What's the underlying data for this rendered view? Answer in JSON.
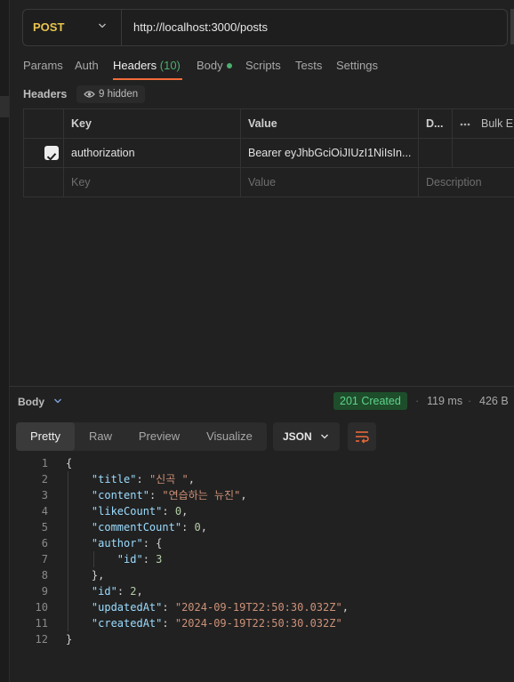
{
  "request": {
    "method": "POST",
    "url": "http://localhost:3000/posts"
  },
  "tabs": [
    {
      "label": "Params"
    },
    {
      "label": "Auth"
    },
    {
      "label": "Headers",
      "count": "(10)"
    },
    {
      "label": "Body"
    },
    {
      "label": "Scripts"
    },
    {
      "label": "Tests"
    },
    {
      "label": "Settings"
    }
  ],
  "headers_section": {
    "title": "Headers",
    "hidden_label": "9 hidden"
  },
  "table": {
    "columns": [
      "Key",
      "Value",
      "D...",
      "Bulk E"
    ],
    "rows": [
      {
        "key": "authorization",
        "value": "Bearer eyJhbGciOiJIUzI1NiIsIn...",
        "checked": true
      }
    ],
    "placeholders": {
      "key": "Key",
      "value": "Value",
      "description": "Description"
    }
  },
  "response": {
    "label": "Body",
    "status": "201 Created",
    "time": "119 ms",
    "size": "426 B",
    "view_tabs": [
      "Pretty",
      "Raw",
      "Preview",
      "Visualize"
    ],
    "format": "JSON",
    "lines": [
      {
        "n": "1",
        "t": "{"
      },
      {
        "n": "2",
        "t": "    \"title\": \"신곡 \","
      },
      {
        "n": "3",
        "t": "    \"content\": \"연습하는 뉴진\","
      },
      {
        "n": "4",
        "t": "    \"likeCount\": 0,"
      },
      {
        "n": "5",
        "t": "    \"commentCount\": 0,"
      },
      {
        "n": "6",
        "t": "    \"author\": {"
      },
      {
        "n": "7",
        "t": "        \"id\": 3"
      },
      {
        "n": "8",
        "t": "    },"
      },
      {
        "n": "9",
        "t": "    \"id\": 2,"
      },
      {
        "n": "10",
        "t": "    \"updatedAt\": \"2024-09-19T22:50:30.032Z\","
      },
      {
        "n": "11",
        "t": "    \"createdAt\": \"2024-09-19T22:50:30.032Z\""
      },
      {
        "n": "12",
        "t": "}"
      }
    ]
  }
}
